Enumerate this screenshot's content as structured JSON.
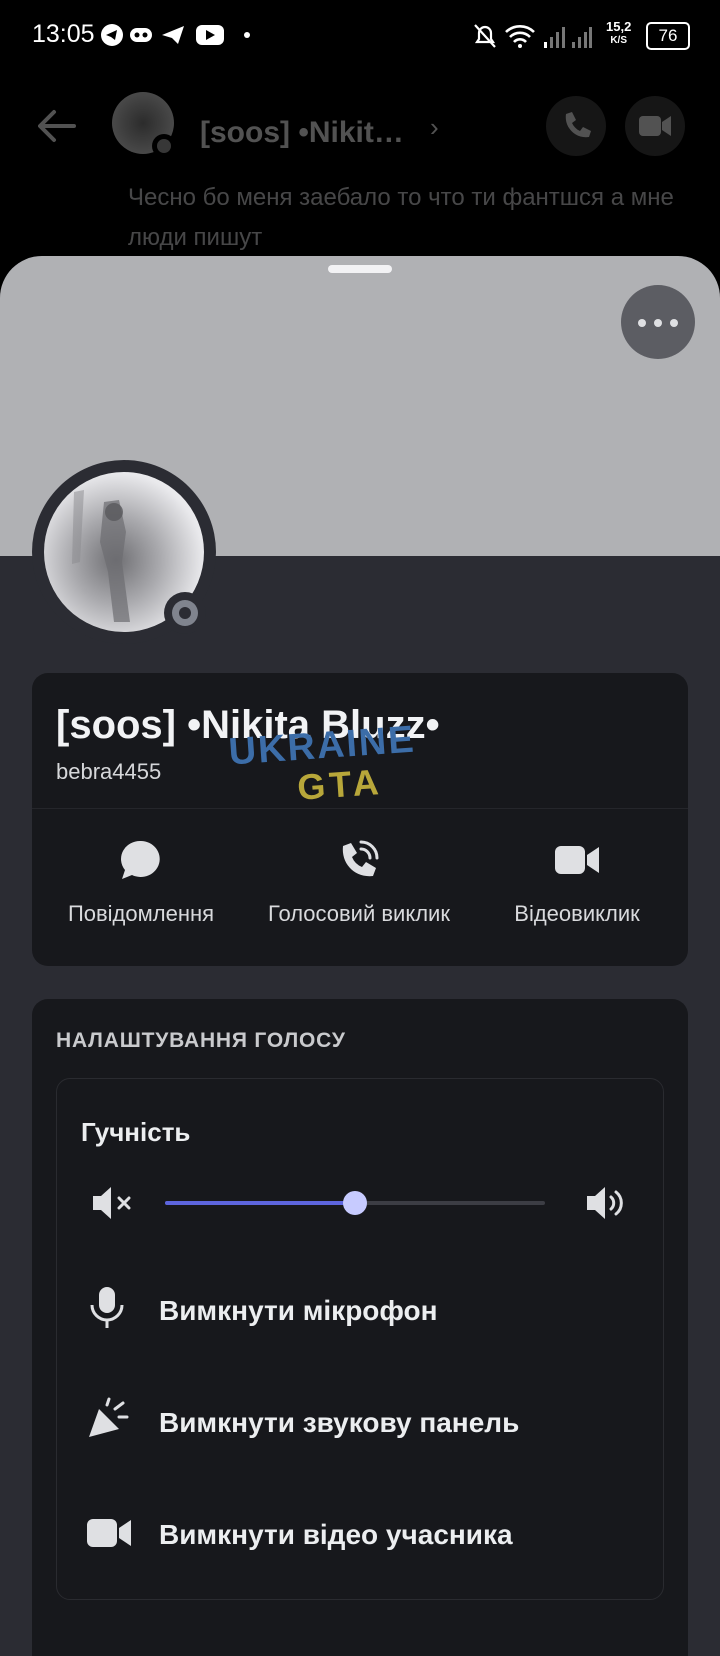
{
  "status_bar": {
    "time": "13:05",
    "net_speed": "15,2",
    "net_unit": "K/S",
    "battery": "76"
  },
  "chat": {
    "title": "[soos] •Nikit…",
    "last_message": "Чесно бо меня заебало то что ти фантшся а мне люди пишут"
  },
  "profile": {
    "display_name": "[soos] •Nikita Bluzz•",
    "username": "bebra4455",
    "actions": [
      {
        "label": "Повідомлення",
        "icon": "message-bubble-icon"
      },
      {
        "label": "Голосовий виклик",
        "icon": "phone-call-icon"
      },
      {
        "label": "Відеовиклик",
        "icon": "video-camera-icon"
      }
    ]
  },
  "watermark": {
    "line1": "UKRAINE",
    "line2": "GTA"
  },
  "voice_settings": {
    "title": "НАЛАШТУВАННЯ ГОЛОСУ",
    "volume_label": "Гучність",
    "volume_level": 0.5,
    "options": [
      {
        "label": "Вимкнути мікрофон",
        "icon": "microphone-icon"
      },
      {
        "label": "Вимкнути звукову панель",
        "icon": "soundboard-icon"
      },
      {
        "label": "Вимкнути відео учасника",
        "icon": "video-camera-icon"
      }
    ]
  },
  "colors": {
    "accent": "#5d65de",
    "sheet_bg": "#2b2c33",
    "card_bg": "#17181c",
    "banner": "#b0b1b4"
  }
}
